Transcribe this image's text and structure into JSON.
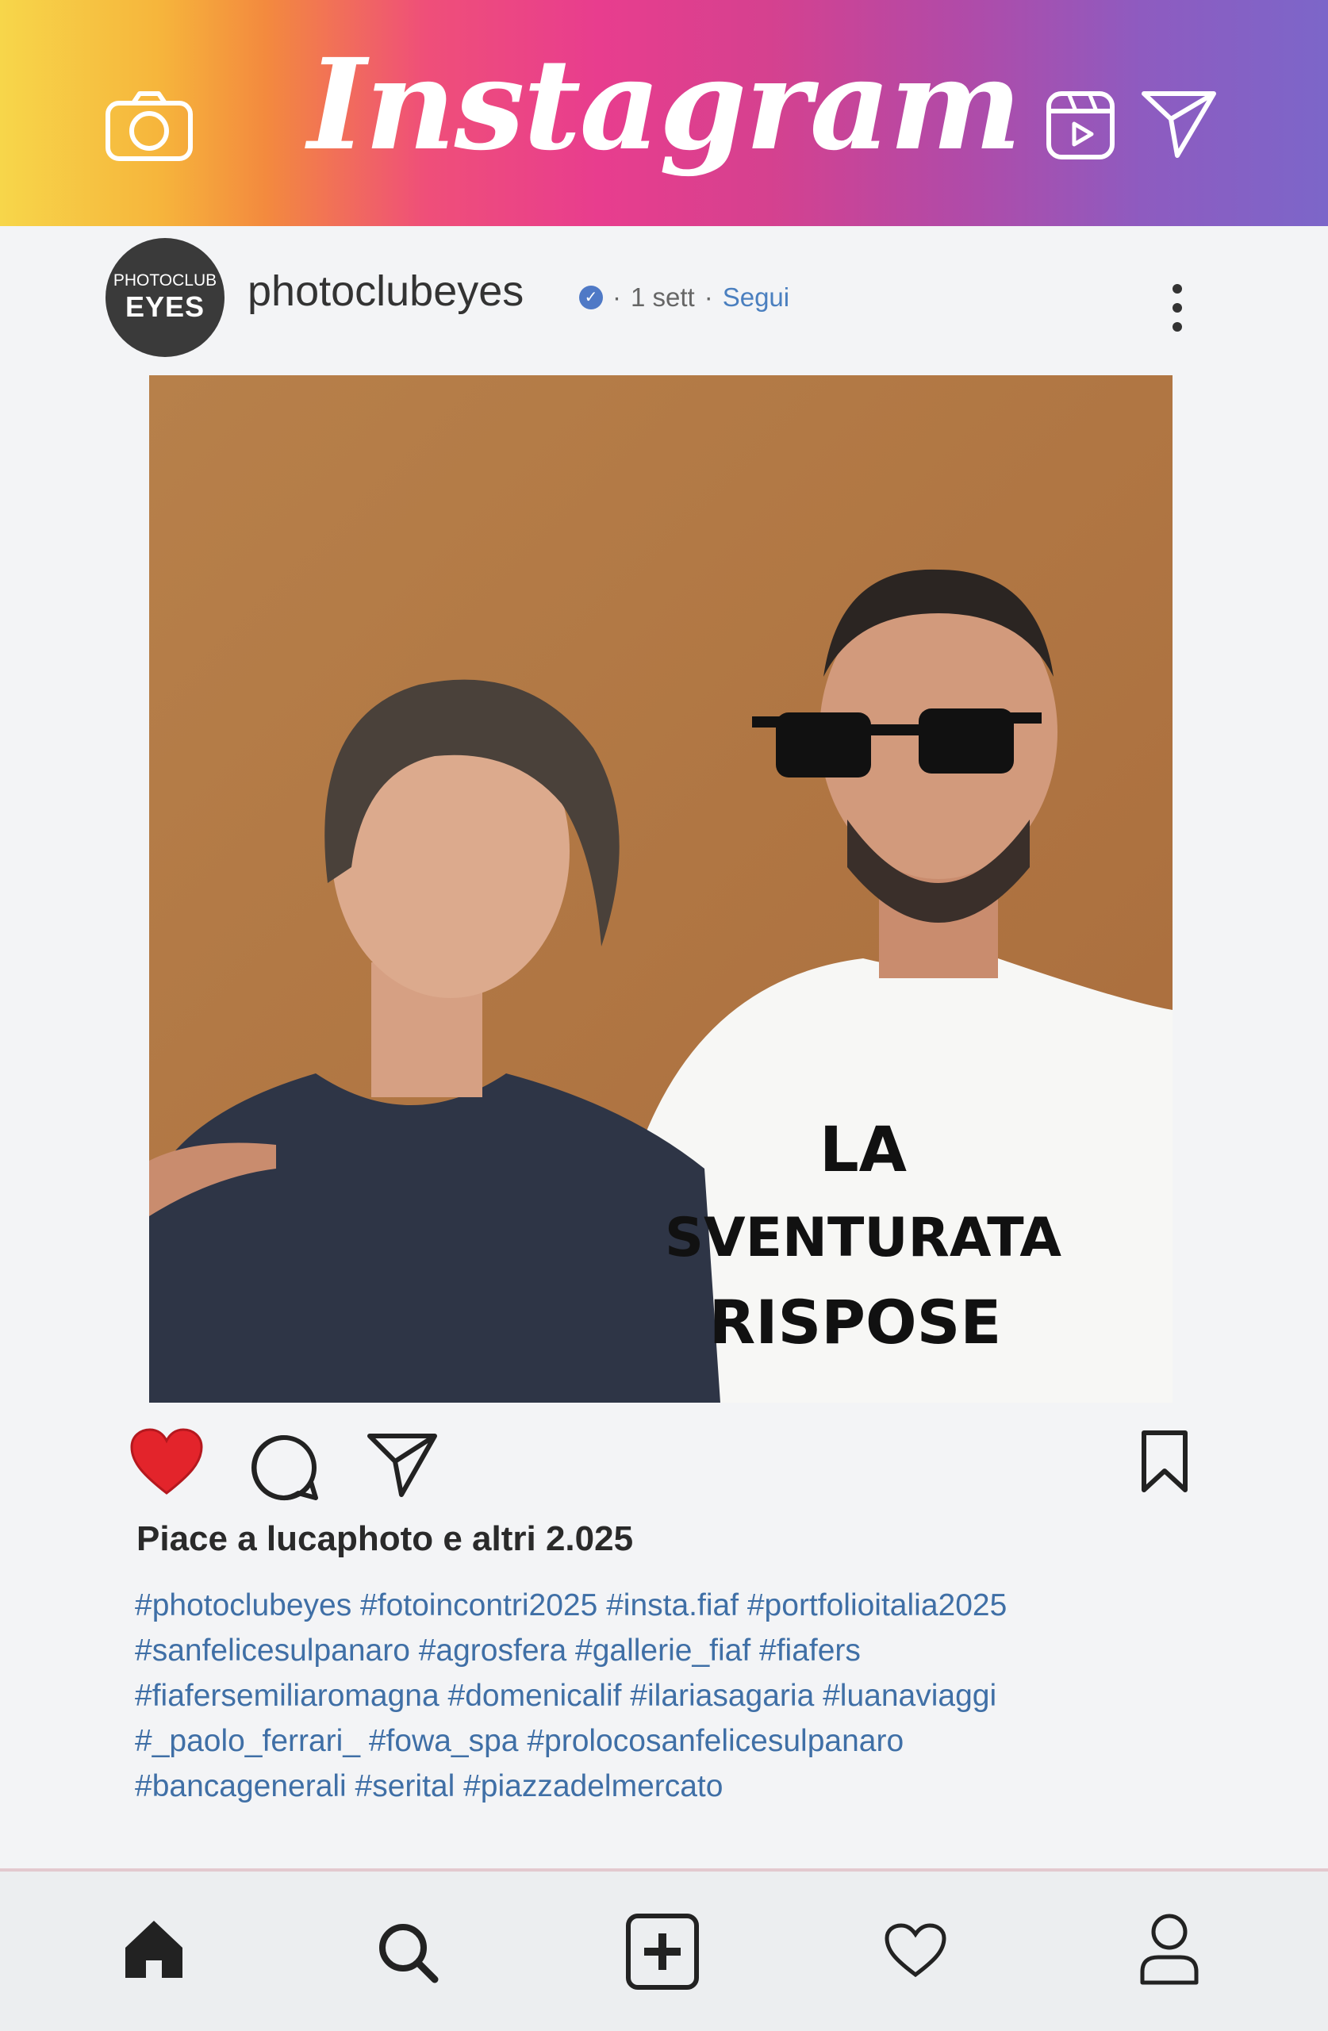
{
  "header": {
    "logo_text": "Instagram",
    "icons": [
      "camera-icon",
      "reels-icon",
      "direct-message-icon"
    ]
  },
  "post": {
    "avatar": {
      "line1": "PHOTOCLUB",
      "line2": "EYES"
    },
    "username": "photoclubeyes",
    "time": "1 sett",
    "separator": "·",
    "follow_label": "Segui",
    "photo_shirt_text": [
      "LA",
      "SVENTURATA",
      "RISPOSE"
    ],
    "likes_text": "Piace a lucaphoto e altri 2.025",
    "hashtag_lines": [
      "#photoclubeyes #fotoincontri2025 #insta.fiaf #portfolioitalia2025",
      "#sanfelicesulpanaro #agrosfera #gallerie_fiaf #fiafers",
      "#fiafersemiliaromagna #domenicalif #ilariasagaria #luanaviaggi",
      "#_paolo_ferrari_ #fowa_spa #prolocosanfelicesulpanaro",
      "#bancagenerali #serital #piazzadelmercato"
    ]
  },
  "colors": {
    "like_red": "#e3242b",
    "hashtag_blue": "#3f6fa6",
    "follow_blue": "#4a7fbf"
  },
  "bottom_nav": {
    "items": [
      "home-icon",
      "search-icon",
      "add-post-icon",
      "activity-heart-icon",
      "profile-icon"
    ]
  }
}
